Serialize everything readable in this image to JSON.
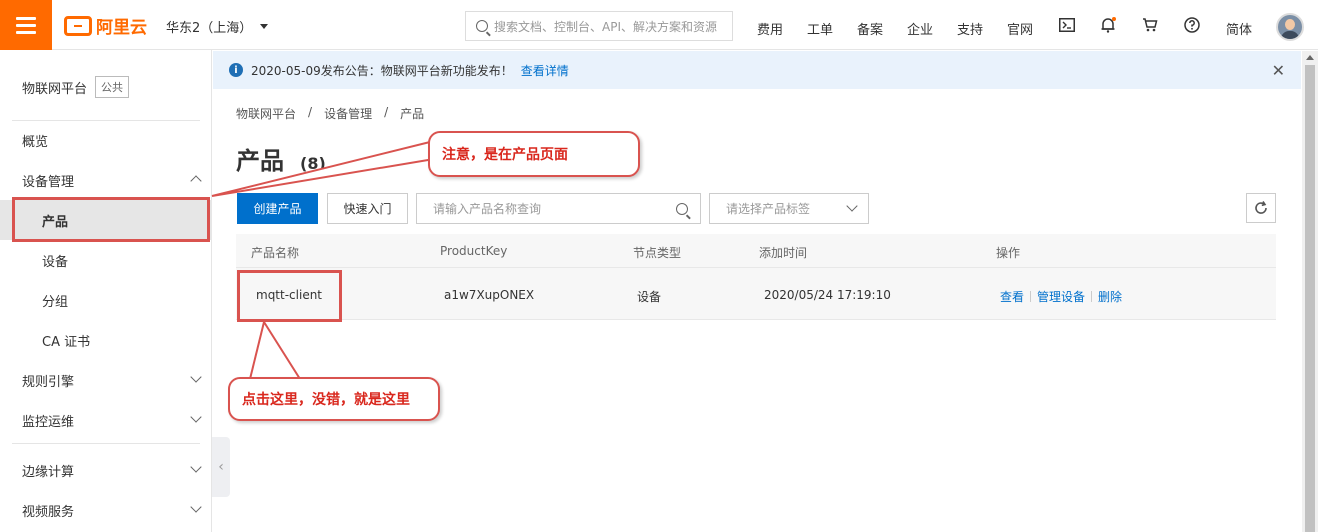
{
  "topbar": {
    "logo_text": "阿里云",
    "region": "华东2（上海）",
    "search_placeholder": "搜索文档、控制台、API、解决方案和资源",
    "links": [
      "费用",
      "工单",
      "备案",
      "企业",
      "支持",
      "官网"
    ],
    "language": "简体",
    "icons": [
      "menu-icon",
      "terminal-icon",
      "bell-icon",
      "cart-icon",
      "help-icon"
    ],
    "accent_color": "#ff6a00"
  },
  "sidebar": {
    "title": "物联网平台",
    "tag": "公共",
    "items": [
      {
        "label": "概览"
      },
      {
        "label": "设备管理"
      },
      {
        "label": "产品"
      },
      {
        "label": "设备"
      },
      {
        "label": "分组"
      },
      {
        "label": "CA 证书"
      },
      {
        "label": "规则引擎"
      },
      {
        "label": "监控运维"
      },
      {
        "label": "边缘计算"
      },
      {
        "label": "视频服务"
      }
    ]
  },
  "notice": {
    "text": "2020-05-09发布公告：物联网平台新功能发布！",
    "link": "查看详情"
  },
  "breadcrumb": [
    "物联网平台",
    "/",
    "设备管理",
    "/",
    "产品"
  ],
  "page": {
    "title": "产品",
    "count": "(8)"
  },
  "toolbar": {
    "create_label": "创建产品",
    "quickstart_label": "快速入门",
    "search_placeholder": "请输入产品名称查询",
    "tag_placeholder": "请选择产品标签"
  },
  "table": {
    "headers": [
      "产品名称",
      "ProductKey",
      "节点类型",
      "添加时间",
      "操作"
    ],
    "rows": [
      {
        "name": "mqtt-client",
        "product_key": "a1w7XupONEX",
        "node_type": "设备",
        "created": "2020/05/24 17:19:10",
        "actions": [
          "查看",
          "管理设备",
          "删除"
        ]
      }
    ]
  },
  "annotations": {
    "callout_top": "注意，是在产品页面",
    "callout_bottom": "点击这里，没错，就是这里",
    "color": "#d9534f"
  }
}
